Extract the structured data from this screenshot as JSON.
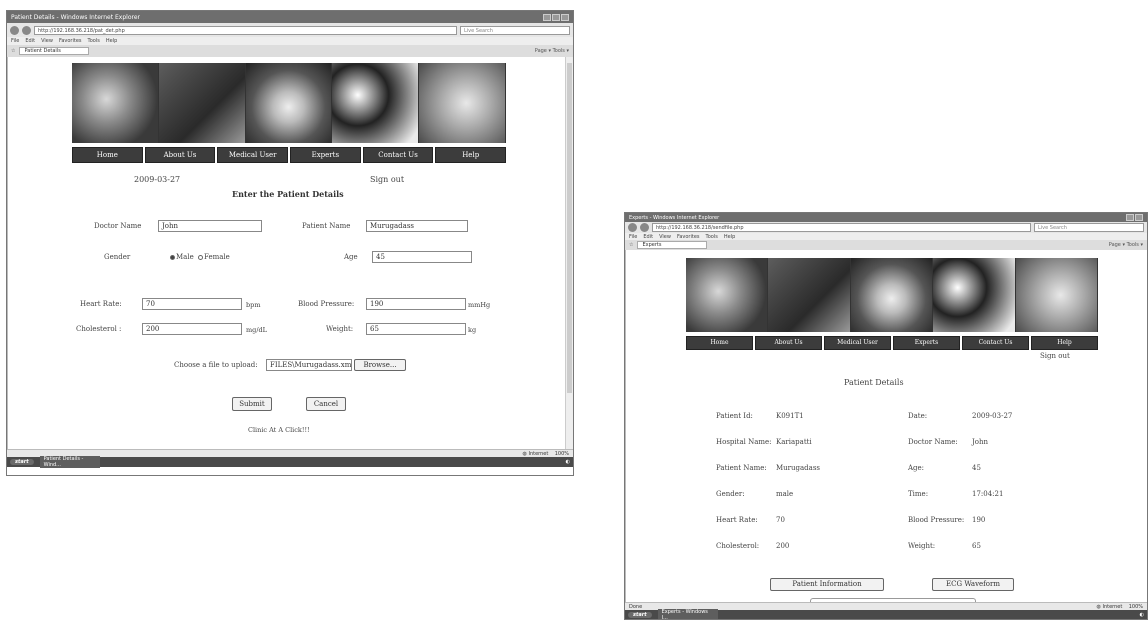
{
  "left_window": {
    "title": "Patient Details - Windows Internet Explorer",
    "url": "http://192.168.36.218/pat_det.php",
    "search_placeholder": "Live Search",
    "menu": [
      "File",
      "Edit",
      "View",
      "Favorites",
      "Tools",
      "Help"
    ],
    "tab": "Patient Details",
    "tools": "Page ▾  Tools ▾",
    "nav": [
      "Home",
      "About Us",
      "Medical User",
      "Experts",
      "Contact Us",
      "Help"
    ],
    "date": "2009-03-27",
    "signout": "Sign out",
    "heading": "Enter the Patient Details",
    "form": {
      "doctor_label": "Doctor Name",
      "doctor_value": "John",
      "patient_label": "Patient Name",
      "patient_value": "Murugadass",
      "gender_label": "Gender",
      "male": "Male",
      "female": "Female",
      "age_label": "Age",
      "age_value": "45",
      "heart_label": "Heart Rate:",
      "heart_value": "70",
      "heart_unit": "bpm",
      "bp_label": "Blood Pressure:",
      "bp_value": "190",
      "bp_unit": "mmHg",
      "chol_label": "Cholesterol :",
      "chol_value": "200",
      "chol_unit": "mg/dL",
      "weight_label": "Weight:",
      "weight_value": "65",
      "weight_unit": "kg",
      "file_label": "Choose a file to upload:",
      "file_value": "FILES\\Murugadass.xml",
      "browse": "Browse...",
      "submit": "Submit",
      "cancel": "Cancel"
    },
    "footer": "Clinic At A Click!!!",
    "status_zone": "Internet",
    "zoom": "100%",
    "start": "start",
    "task": "Patient Details - Wind..."
  },
  "right_window": {
    "title": "Experts - Windows Internet Explorer",
    "url": "http://192.168.36.218/sendfile.php",
    "search_placeholder": "Live Search",
    "menu": [
      "File",
      "Edit",
      "View",
      "Favorites",
      "Tools",
      "Help"
    ],
    "tab": "Experts",
    "tools": "Page ▾  Tools ▾",
    "nav": [
      "Home",
      "About Us",
      "Medical User",
      "Experts",
      "Contact Us",
      "Help"
    ],
    "signout": "Sign out",
    "heading": "Patient Details",
    "details": [
      {
        "l1": "Patient Id:",
        "v1": "K091T1",
        "l2": "Date:",
        "v2": "2009-03-27"
      },
      {
        "l1": "Hospital Name:",
        "v1": "Kariapatti",
        "l2": "Doctor Name:",
        "v2": "John"
      },
      {
        "l1": "Patient Name:",
        "v1": "Murugadass",
        "l2": "Age:",
        "v2": "45"
      },
      {
        "l1": "Gender:",
        "v1": "male",
        "l2": "Time:",
        "v2": "17:04:21"
      },
      {
        "l1": "Heart Rate:",
        "v1": "70",
        "l2": "Blood Pressure:",
        "v2": "190"
      },
      {
        "l1": "Cholesterol:",
        "v1": "200",
        "l2": "Weight:",
        "v2": "65"
      }
    ],
    "btn_info": "Patient Information",
    "btn_ecg": "ECG Waveform",
    "status_left": "Done",
    "status_zone": "Internet",
    "zoom": "100%",
    "start": "start",
    "task": "Experts - Windows I..."
  }
}
